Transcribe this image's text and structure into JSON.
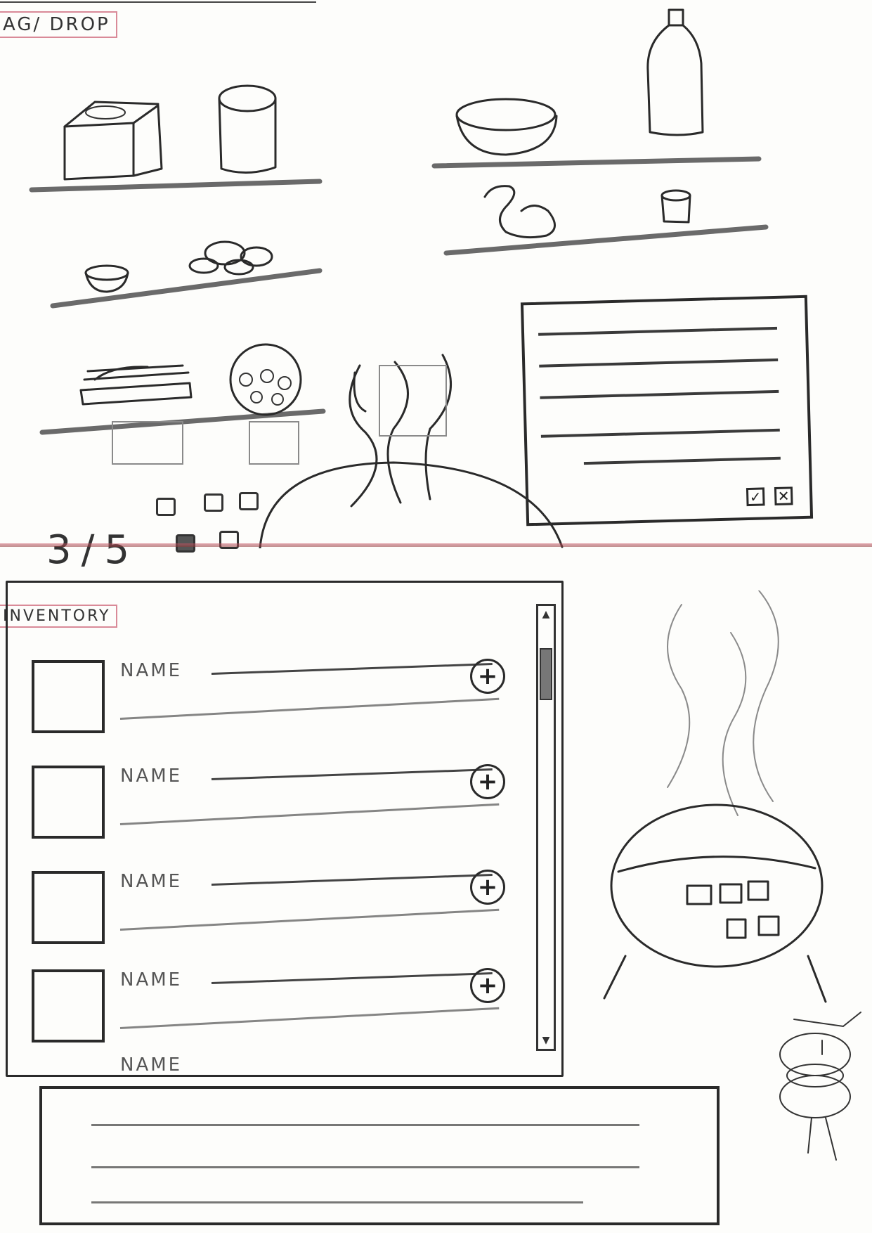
{
  "header": {
    "title": "AG/ DROP"
  },
  "scene": {
    "counter": "3/5",
    "ingredient_slots_total": 5,
    "ingredient_slots_filled": 3
  },
  "popup": {
    "confirm_icon": "check-icon",
    "cancel_icon": "x-icon",
    "confirm_label": "✓",
    "cancel_label": "✕"
  },
  "inventory": {
    "title": "INVENTORY",
    "items": [
      {
        "name": "NAME",
        "add_label": "+"
      },
      {
        "name": "NAME",
        "add_label": "+"
      },
      {
        "name": "NAME",
        "add_label": "+"
      },
      {
        "name": "NAME",
        "add_label": "+"
      },
      {
        "name": "NAME"
      }
    ],
    "scroll_up_label": "▲",
    "scroll_down_label": "▼"
  }
}
